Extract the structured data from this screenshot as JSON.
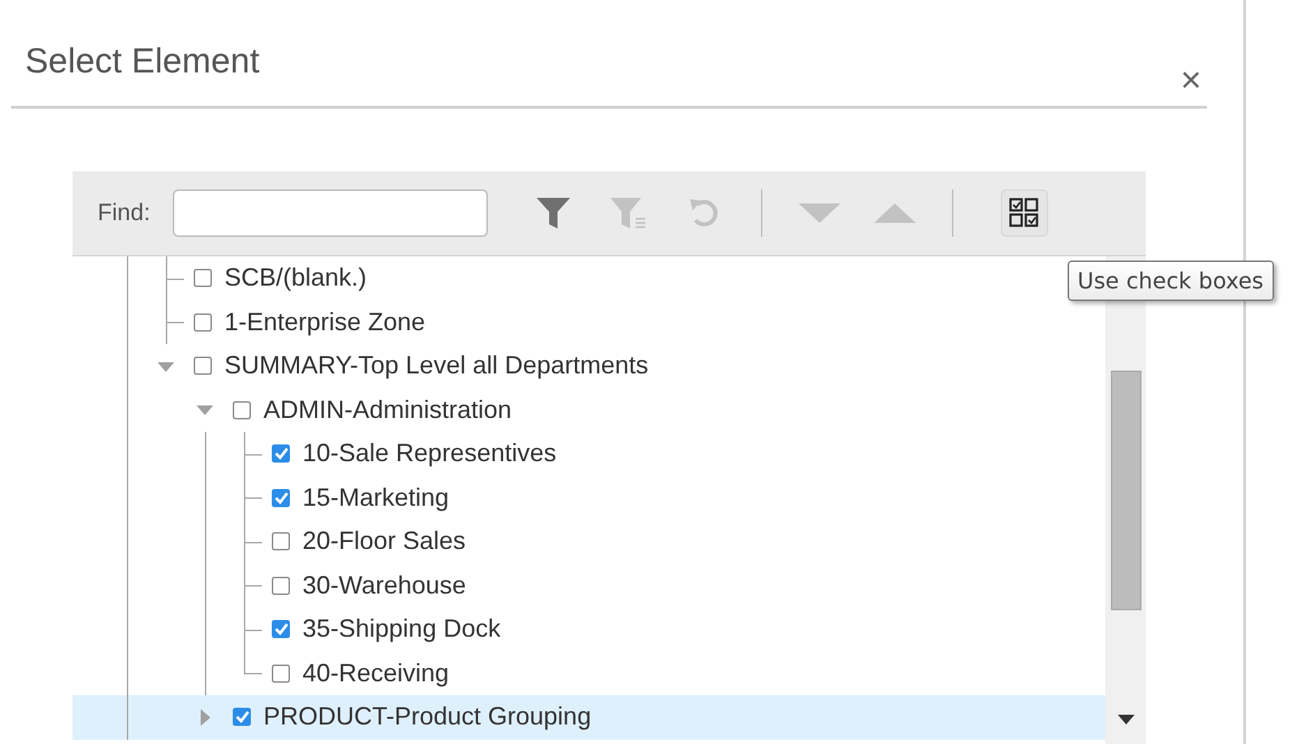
{
  "dialog": {
    "title": "Select Element",
    "close": "×"
  },
  "toolbar": {
    "find_label": "Find:",
    "tools": [
      {
        "kind": "filter",
        "disabled": false
      },
      {
        "kind": "clear-filter",
        "disabled": true
      },
      {
        "kind": "reset",
        "disabled": true
      },
      {
        "kind": "separator"
      },
      {
        "kind": "next",
        "disabled": true
      },
      {
        "kind": "previous",
        "disabled": true
      },
      {
        "kind": "separator"
      }
    ],
    "checkbox_toggle": {
      "tooltip": "Use check boxes"
    }
  },
  "tree": [
    {
      "label": "SCB/(blank.)",
      "checked": false,
      "selected": false
    },
    {
      "label": "1-Enterprise Zone",
      "checked": false,
      "selected": false
    },
    {
      "label": "SUMMARY-Top Level all Departments",
      "checked": false,
      "selected": false,
      "expanded": true,
      "children": [
        {
          "label": "ADMIN-Administration",
          "checked": false,
          "selected": false,
          "expanded": true,
          "children": [
            {
              "label": "10-Sale Representives",
              "checked": true,
              "selected": false
            },
            {
              "label": "15-Marketing",
              "checked": true,
              "selected": false
            },
            {
              "label": "20-Floor Sales",
              "checked": false,
              "selected": false
            },
            {
              "label": "30-Warehouse",
              "checked": false,
              "selected": false
            },
            {
              "label": "35-Shipping Dock",
              "checked": true,
              "selected": false
            },
            {
              "label": "40-Receiving",
              "checked": false,
              "selected": false
            }
          ]
        },
        {
          "label": "PRODUCT-Product Grouping",
          "checked": true,
          "selected": true,
          "expanded": false
        }
      ]
    }
  ]
}
